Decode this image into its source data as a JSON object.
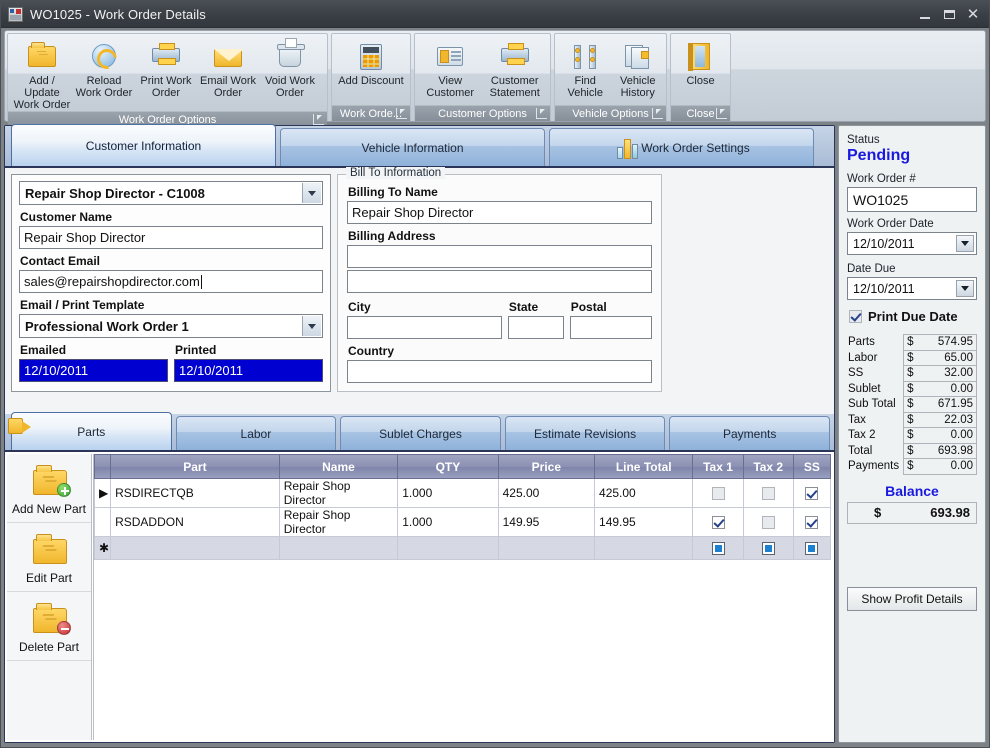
{
  "window": {
    "title": "WO1025 - Work Order Details",
    "icon": "app-icon",
    "minimize": "–",
    "maximize": "□",
    "close": "✕"
  },
  "ribbon": {
    "groups": [
      {
        "caption": "Work Order Options",
        "has_dialog_launcher": true,
        "items": [
          {
            "label": "Add / Update\nWork Order",
            "line1": "Add / Update",
            "line2": "Work Order",
            "icon": "folder-icon"
          },
          {
            "label": "Reload Work Order",
            "line1": "Reload",
            "line2": "Work Order",
            "icon": "reload-icon"
          },
          {
            "label": "Print Work Order",
            "line1": "Print Work",
            "line2": "Order",
            "icon": "printer-icon"
          },
          {
            "label": "Email Work Order",
            "line1": "Email Work",
            "line2": "Order",
            "icon": "mail-icon"
          },
          {
            "label": "Void Work Order",
            "line1": "Void Work",
            "line2": "Order",
            "icon": "trash-icon"
          }
        ]
      },
      {
        "caption": "Work Orde...",
        "has_dialog_launcher": true,
        "items": [
          {
            "label": "Add Discount",
            "line1": "Add Discount",
            "line2": "",
            "icon": "calculator-icon"
          }
        ]
      },
      {
        "caption": "Customer Options",
        "has_dialog_launcher": true,
        "items": [
          {
            "label": "View Customer",
            "line1": "View Customer",
            "line2": "",
            "icon": "customer-card-icon"
          },
          {
            "label": "Customer Statement",
            "line1": "Customer",
            "line2": "Statement",
            "icon": "printer-icon"
          }
        ]
      },
      {
        "caption": "Vehicle Options",
        "has_dialog_launcher": true,
        "items": [
          {
            "label": "Find Vehicle",
            "line1": "Find Vehicle",
            "line2": "",
            "icon": "vehicle-lift-icon"
          },
          {
            "label": "Vehicle History",
            "line1": "Vehicle",
            "line2": "History",
            "icon": "documents-icon"
          }
        ]
      },
      {
        "caption": "Close",
        "has_dialog_launcher": true,
        "items": [
          {
            "label": "Close",
            "line1": "Close",
            "line2": "",
            "icon": "door-icon"
          }
        ]
      }
    ]
  },
  "top_tabs": [
    {
      "label": "Customer Information",
      "active": true,
      "icon": null
    },
    {
      "label": "Vehicle Information",
      "active": false,
      "icon": null
    },
    {
      "label": "Work Order Settings",
      "active": false,
      "icon": "bar-chart-icon"
    }
  ],
  "customer": {
    "selected_customer": "Repair Shop Director - C1008",
    "name_label": "Customer Name",
    "name_value": "Repair Shop Director",
    "email_label": "Contact Email",
    "email_value": "sales@repairshopdirector.com",
    "template_label": "Email / Print Template",
    "template_value": "Professional Work Order 1",
    "emailed_label": "Emailed",
    "emailed_value": "12/10/2011",
    "printed_label": "Printed",
    "printed_value": "12/10/2011"
  },
  "bill_to": {
    "legend": "Bill To Information",
    "billing_name_label": "Billing To Name",
    "billing_name_value": "Repair Shop Director",
    "billing_address_label": "Billing Address",
    "billing_address_1": "",
    "billing_address_2": "",
    "city_label": "City",
    "city_value": "",
    "state_label": "State",
    "state_value": "",
    "postal_label": "Postal",
    "postal_value": "",
    "country_label": "Country",
    "country_value": ""
  },
  "lower_tabs": [
    {
      "label": "Parts",
      "active": true,
      "icon": "parts-arrow-icon"
    },
    {
      "label": "Labor",
      "active": false,
      "icon": null
    },
    {
      "label": "Sublet Charges",
      "active": false,
      "icon": null
    },
    {
      "label": "Estimate Revisions",
      "active": false,
      "icon": null
    },
    {
      "label": "Payments",
      "active": false,
      "icon": null
    }
  ],
  "part_actions": [
    {
      "label": "Add New Part",
      "icon": "folder-add-icon",
      "badge": "green"
    },
    {
      "label": "Edit Part",
      "icon": "folder-icon",
      "badge": null
    },
    {
      "label": "Delete Part",
      "icon": "folder-delete-icon",
      "badge": "red"
    }
  ],
  "parts_grid": {
    "columns": [
      "Part",
      "Name",
      "QTY",
      "Price",
      "Line Total",
      "Tax 1",
      "Tax 2",
      "SS"
    ],
    "rows": [
      {
        "selected": true,
        "part": "RSDIRECTQB",
        "name": "Repair Shop Director",
        "qty": "1.000",
        "price": "425.00",
        "line_total": "425.00",
        "tax1": false,
        "tax2": false,
        "ss": true
      },
      {
        "selected": false,
        "part": "RSDADDON",
        "name": "Repair Shop Director",
        "qty": "1.000",
        "price": "149.95",
        "line_total": "149.95",
        "tax1": true,
        "tax2": false,
        "ss": true
      }
    ],
    "new_row_marker": "✱"
  },
  "sidebar": {
    "status_label": "Status",
    "status_value": "Pending",
    "wo_number_label": "Work Order #",
    "wo_number_value": "WO1025",
    "wo_date_label": "Work Order Date",
    "wo_date_value": "12/10/2011",
    "date_due_label": "Date Due",
    "date_due_value": "12/10/2011",
    "print_due_date_label": "Print Due Date",
    "print_due_date_checked": true,
    "totals": [
      {
        "key": "Parts",
        "currency": "$",
        "value": "574.95"
      },
      {
        "key": "Labor",
        "currency": "$",
        "value": "65.00"
      },
      {
        "key": "SS",
        "currency": "$",
        "value": "32.00"
      },
      {
        "key": "Sublet",
        "currency": "$",
        "value": "0.00"
      },
      {
        "key": "Sub Total",
        "currency": "$",
        "value": "671.95"
      },
      {
        "key": "Tax",
        "currency": "$",
        "value": "22.03"
      },
      {
        "key": "Tax 2",
        "currency": "$",
        "value": "0.00"
      },
      {
        "key": "Total",
        "currency": "$",
        "value": "693.98"
      },
      {
        "key": "Payments",
        "currency": "$",
        "value": "0.00"
      }
    ],
    "balance_label": "Balance",
    "balance_currency": "$",
    "balance_value": "693.98",
    "profit_button": "Show Profit Details"
  },
  "colors": {
    "titlebar": "#3b4047",
    "accent_blue": "#1919e0",
    "tab_border": "#2a3558",
    "grid_header": "#8b90b3",
    "highlight": "#0000d0"
  }
}
